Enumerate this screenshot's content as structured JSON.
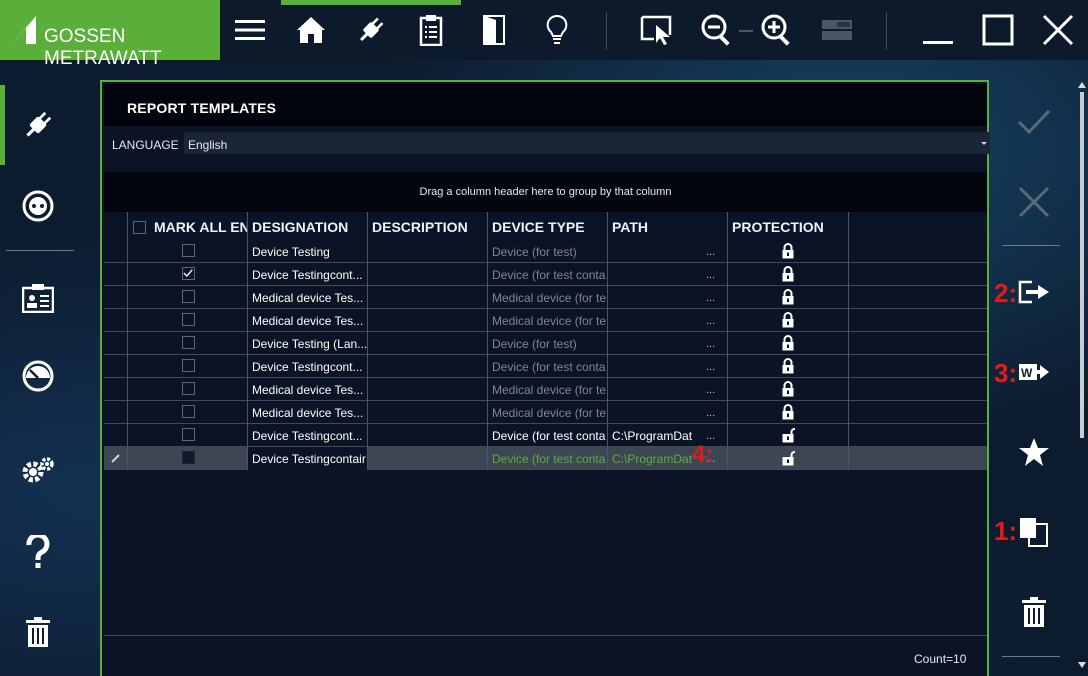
{
  "brand": {
    "name": "GOSSEN METRAWATT",
    "color": "#5aae3a"
  },
  "toolbar": {
    "items": [
      {
        "name": "menu-icon"
      },
      {
        "name": "home-icon"
      },
      {
        "name": "plug-icon"
      },
      {
        "name": "clipboard-icon"
      },
      {
        "name": "door-icon"
      },
      {
        "name": "lightbulb-icon"
      },
      {
        "name": "select-cursor-icon"
      },
      {
        "name": "zoom-out-icon"
      },
      {
        "name": "zoom-in-icon"
      },
      {
        "name": "layout-icon"
      },
      {
        "name": "minimize-icon"
      },
      {
        "name": "maximize-icon"
      },
      {
        "name": "close-icon"
      }
    ]
  },
  "left_sidebar": {
    "items": [
      {
        "name": "plug-icon",
        "active": true
      },
      {
        "name": "socket-icon"
      },
      {
        "name": "id-card-icon"
      },
      {
        "name": "gauge-icon"
      },
      {
        "name": "gears-icon"
      },
      {
        "name": "help-icon"
      },
      {
        "name": "trash-icon"
      }
    ]
  },
  "right_sidebar": {
    "items": [
      {
        "name": "check-icon"
      },
      {
        "name": "cancel-icon"
      },
      {
        "name": "export-icon",
        "marker": "2:"
      },
      {
        "name": "word-export-icon",
        "marker": "3:"
      },
      {
        "name": "star-icon"
      },
      {
        "name": "copy-icon",
        "marker": "1:"
      },
      {
        "name": "trash-icon"
      }
    ]
  },
  "panel": {
    "title": "REPORT TEMPLATES",
    "language_label": "LANGUAGE",
    "language_value": "English",
    "group_hint": "Drag a column header here to group by that column",
    "count": "Count=10",
    "marker_4": "4:"
  },
  "grid": {
    "columns": [
      {
        "key": "mark",
        "label": "MARK ALL EN"
      },
      {
        "key": "designation",
        "label": "DESIGNATION"
      },
      {
        "key": "description",
        "label": "DESCRIPTION"
      },
      {
        "key": "device_type",
        "label": "DEVICE TYPE"
      },
      {
        "key": "path",
        "label": "PATH"
      },
      {
        "key": "protection",
        "label": "PROTECTION"
      }
    ],
    "rows": [
      {
        "checked": false,
        "designation": "Device Testing",
        "description": "",
        "device_type": "Device (for test)",
        "path": "",
        "locked": true,
        "style": "dim"
      },
      {
        "checked": true,
        "designation": "Device Testingcont...",
        "description": "",
        "device_type": "Device (for test conta",
        "path": "",
        "locked": true,
        "style": "dim"
      },
      {
        "checked": false,
        "designation": "Medical device Tes...",
        "description": "",
        "device_type": "Medical device (for te",
        "path": "",
        "locked": true,
        "style": "dim"
      },
      {
        "checked": false,
        "designation": "Medical device Tes...",
        "description": "",
        "device_type": "Medical device (for te",
        "path": "",
        "locked": true,
        "style": "dim"
      },
      {
        "checked": false,
        "designation": "Device Testing (Lan...",
        "description": "",
        "device_type": "Device (for test)",
        "path": "",
        "locked": true,
        "style": "dim"
      },
      {
        "checked": false,
        "designation": "Device Testingcont...",
        "description": "",
        "device_type": "Device (for test conta",
        "path": "",
        "locked": true,
        "style": "dim"
      },
      {
        "checked": false,
        "designation": "Medical device Tes...",
        "description": "",
        "device_type": "Medical device (for te",
        "path": "",
        "locked": true,
        "style": "dim"
      },
      {
        "checked": false,
        "designation": "Medical device Tes...",
        "description": "",
        "device_type": "Medical device (for te",
        "path": "",
        "locked": true,
        "style": "dim"
      },
      {
        "checked": false,
        "designation": "Device Testingcont...",
        "description": "",
        "device_type": "Device (for test conta",
        "path": "C:\\ProgramDat",
        "locked": false,
        "style": "normal"
      },
      {
        "checked": false,
        "designation": "Device Testingcontair",
        "description": "",
        "device_type": "Device (for test conta",
        "path": "C:\\ProgramDat",
        "locked": false,
        "style": "green",
        "selected": true
      }
    ],
    "ellipsis": "..."
  }
}
